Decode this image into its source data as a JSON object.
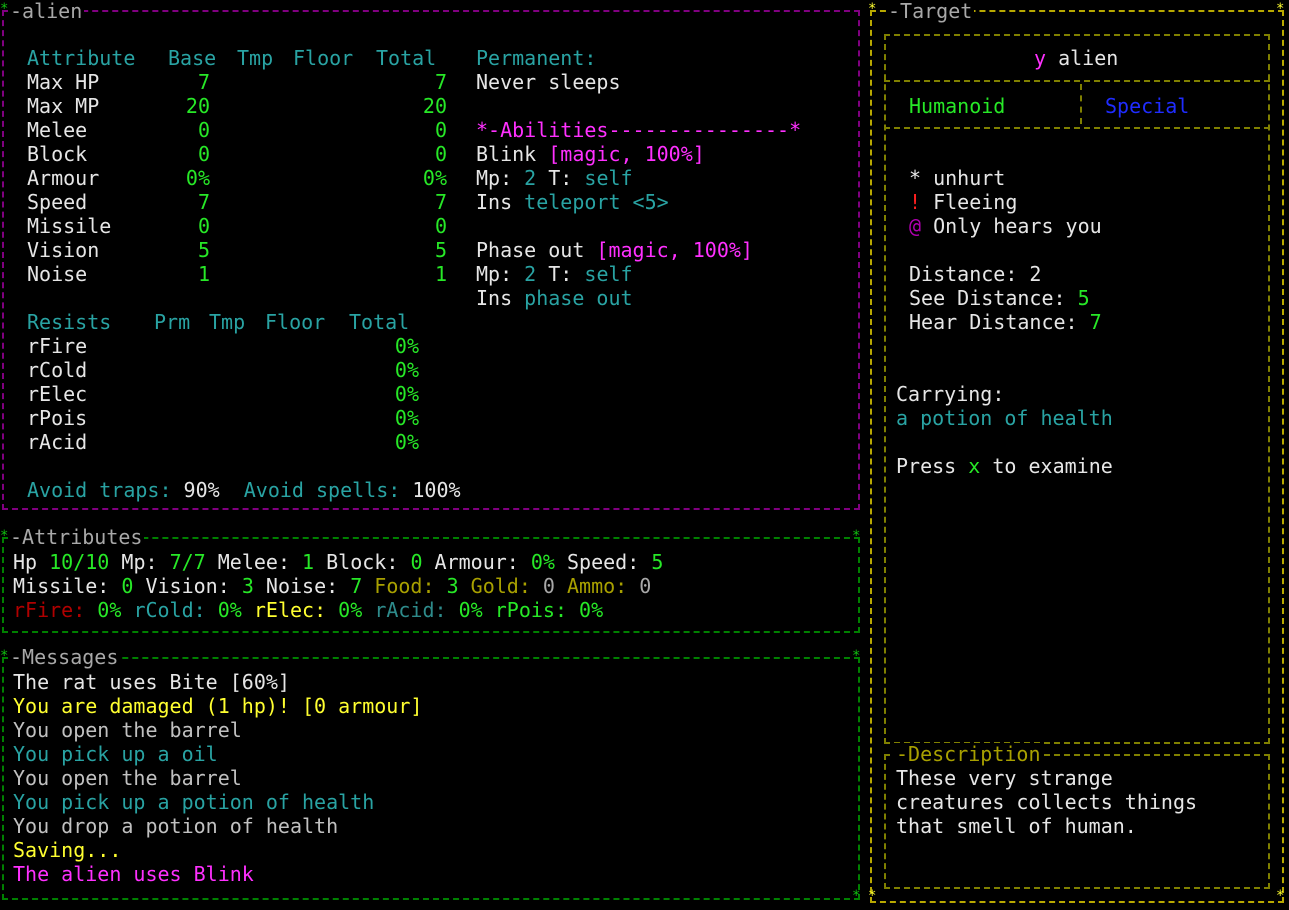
{
  "monster_panel": {
    "title": "alien",
    "attr_header": {
      "attribute": "Attribute",
      "base": "Base",
      "tmp": "Tmp",
      "floor": "Floor",
      "total": "Total"
    },
    "attributes": [
      {
        "name": "Max HP",
        "base": "7",
        "total": "7"
      },
      {
        "name": "Max MP",
        "base": "20",
        "total": "20"
      },
      {
        "name": "Melee",
        "base": "0",
        "total": "0"
      },
      {
        "name": "Block",
        "base": "0",
        "total": "0"
      },
      {
        "name": "Armour",
        "base": "0%",
        "total": "0%"
      },
      {
        "name": "Speed",
        "base": "7",
        "total": "7"
      },
      {
        "name": "Missile",
        "base": "0",
        "total": "0"
      },
      {
        "name": "Vision",
        "base": "5",
        "total": "5"
      },
      {
        "name": "Noise",
        "base": "1",
        "total": "1"
      }
    ],
    "permanent_label": "Permanent:",
    "permanent_value": "Never sleeps",
    "abilities_header": "*-Abilities---------------*",
    "abilities": [
      {
        "name": "Blink",
        "tag": "[magic, 100%]",
        "mp_label": "Mp:",
        "mp": "2",
        "t_label": "T:",
        "target": "self",
        "ins_label": "Ins",
        "ins": "teleport <5>"
      },
      {
        "name": "Phase out",
        "tag": "[magic, 100%]",
        "mp_label": "Mp:",
        "mp": "2",
        "t_label": "T:",
        "target": "self",
        "ins_label": "Ins",
        "ins": "phase out"
      }
    ],
    "resist_header": {
      "resists": "Resists",
      "prm": "Prm",
      "tmp": "Tmp",
      "floor": "Floor",
      "total": "Total"
    },
    "resists": [
      {
        "name": "rFire",
        "total": "0%"
      },
      {
        "name": "rCold",
        "total": "0%"
      },
      {
        "name": "rElec",
        "total": "0%"
      },
      {
        "name": "rPois",
        "total": "0%"
      },
      {
        "name": "rAcid",
        "total": "0%"
      }
    ],
    "avoid_traps_label": "Avoid traps:",
    "avoid_traps": "90%",
    "avoid_spells_label": "Avoid spells:",
    "avoid_spells": "100%"
  },
  "attributes_panel": {
    "title": "Attributes",
    "hp_label": "Hp",
    "hp": "10/10",
    "mp_label": "Mp:",
    "mp": "7/7",
    "melee_label": "Melee:",
    "melee": "1",
    "block_label": "Block:",
    "block": "0",
    "armour_label": "Armour:",
    "armour": "0%",
    "speed_label": "Speed:",
    "speed": "5",
    "missile_label": "Missile:",
    "missile": "0",
    "vision_label": "Vision:",
    "vision": "3",
    "noise_label": "Noise:",
    "noise": "7",
    "food_label": "Food:",
    "food": "3",
    "gold_label": "Gold:",
    "gold": "0",
    "ammo_label": "Ammo:",
    "ammo": "0",
    "rfire_label": "rFire:",
    "rfire": "0%",
    "rcold_label": "rCold:",
    "rcold": "0%",
    "relec_label": "rElec:",
    "relec": "0%",
    "racid_label": "rAcid:",
    "racid": "0%",
    "rpois_label": "rPois:",
    "rpois": "0%"
  },
  "messages_panel": {
    "title": "Messages",
    "messages": [
      {
        "text": "The rat uses Bite [60%]",
        "color": "#e6e6e6"
      },
      {
        "text": "You are damaged (1 hp)! [0 armour]",
        "color": "#ffff30"
      },
      {
        "text": "You open the barrel",
        "color": "#c0c0c0"
      },
      {
        "text": "You pick up a oil",
        "color": "#29a3a3"
      },
      {
        "text": "You open the barrel",
        "color": "#c0c0c0"
      },
      {
        "text": "You pick up a potion of health",
        "color": "#29a3a3"
      },
      {
        "text": "You drop a potion of health",
        "color": "#c0c0c0"
      },
      {
        "text": "Saving...",
        "color": "#ffff30"
      },
      {
        "text": "The alien uses Blink",
        "color": "#ff30ff"
      }
    ]
  },
  "target_panel": {
    "title": "Target",
    "glyph": "y",
    "name": "alien",
    "type": "Humanoid",
    "special": "Special",
    "status": [
      {
        "sym": "*",
        "text": "unhurt"
      },
      {
        "sym": "!",
        "text": "Fleeing"
      },
      {
        "sym": "@",
        "text": "Only hears you"
      }
    ],
    "distance_label": "Distance:",
    "distance": "2",
    "see_label": "See Distance:",
    "see": "5",
    "hear_label": "Hear Distance:",
    "hear": "7",
    "carrying_label": "Carrying:",
    "carrying_item": "a potion of health",
    "press_label": "Press",
    "press_key": "x",
    "press_suffix": "to examine",
    "description_title": "Description",
    "description_lines": [
      "These very strange",
      "creatures collects things",
      "that smell of human."
    ]
  }
}
